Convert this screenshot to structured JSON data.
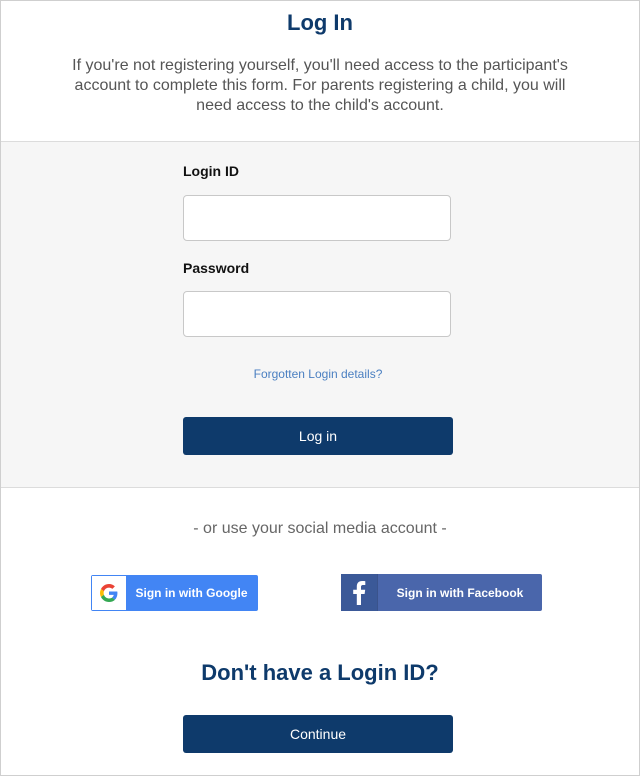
{
  "header": {
    "title": "Log In",
    "intro": "If you're not registering yourself, you'll need access to the participant's account to complete this form. For parents registering a child, you will need access to the child's account."
  },
  "login_form": {
    "login_id_label": "Login ID",
    "login_id_value": "",
    "password_label": "Password",
    "password_value": "",
    "forgot_link": "Forgotten Login details?",
    "login_button": "Log in"
  },
  "social": {
    "divider_text": "- or use your social media account -",
    "google_label": "Sign in with Google",
    "facebook_label": "Sign in with Facebook"
  },
  "signup": {
    "heading": "Don't have a Login ID?",
    "continue_button": "Continue"
  },
  "colors": {
    "brand_navy": "#0e3a6b",
    "link_blue": "#4a7fc1",
    "google_blue": "#4285f4",
    "facebook_blue": "#4a66ab"
  },
  "icons": [
    "google-logo-icon",
    "facebook-logo-icon"
  ]
}
